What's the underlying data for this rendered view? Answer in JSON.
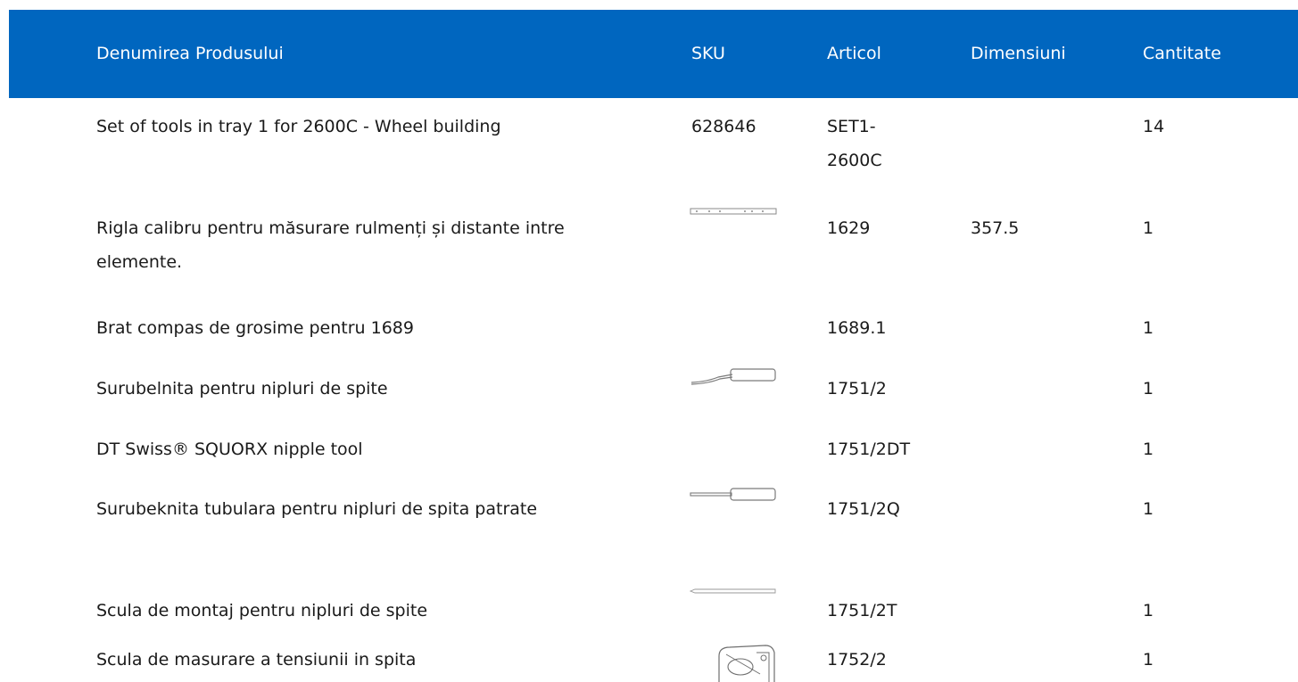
{
  "table": {
    "headers": {
      "name": "Denumirea Produsului",
      "sku": "SKU",
      "article": "Articol",
      "dimensions": "Dimensiuni",
      "quantity": "Cantitate"
    },
    "rows": [
      {
        "name": "Set of tools in tray 1 for 2600C - Wheel building",
        "sku": "628646",
        "article": "SET1-2600C",
        "dimensions": "",
        "quantity": "14",
        "thumbnail": ""
      },
      {
        "name": "Rigla calibru pentru măsurare rulmenți și distante intre elemente.",
        "sku": "",
        "article": "1629",
        "dimensions": "357.5",
        "quantity": "1",
        "thumbnail": "caliper-ruler-image"
      },
      {
        "name": "Brat compas de grosime pentru 1689",
        "sku": "",
        "article": "1689.1",
        "dimensions": "",
        "quantity": "1",
        "thumbnail": ""
      },
      {
        "name": "Surubelnita pentru nipluri de spite",
        "sku": "",
        "article": "1751/2",
        "dimensions": "",
        "quantity": "1",
        "thumbnail": "bent-screwdriver-image"
      },
      {
        "name": "DT Swiss® SQUORX nipple tool",
        "sku": "",
        "article": "1751/2DT",
        "dimensions": "",
        "quantity": "1",
        "thumbnail": ""
      },
      {
        "name": "Surubeknita tubulara pentru nipluri de spita patrate",
        "sku": "",
        "article": "1751/2Q",
        "dimensions": "",
        "quantity": "1",
        "thumbnail": "tubular-screwdriver-image"
      },
      {
        "name": "Scula de montaj pentru nipluri de spite",
        "sku": "",
        "article": "1751/2T",
        "dimensions": "",
        "quantity": "1",
        "thumbnail": "mounting-tool-image"
      },
      {
        "name": "Scula de masurare a tensiunii in spita",
        "sku": "",
        "article": "1752/2",
        "dimensions": "",
        "quantity": "1",
        "thumbnail": "tension-meter-image"
      }
    ]
  },
  "colors": {
    "header_bg": "#0066bf",
    "header_text": "#ffffff",
    "body_text": "#1a1a1a"
  }
}
